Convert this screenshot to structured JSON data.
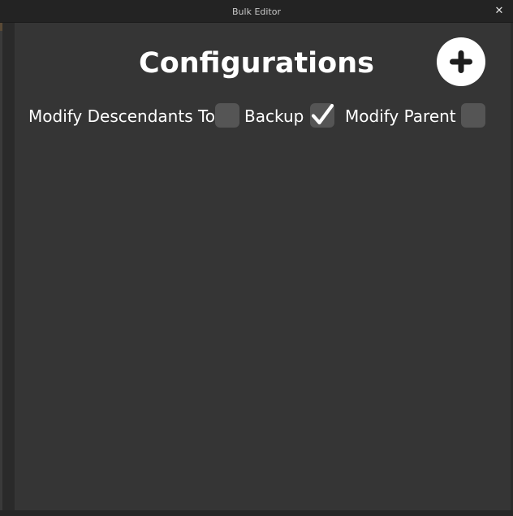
{
  "window": {
    "title": "Bulk Editor",
    "close_glyph": "✕"
  },
  "main": {
    "heading": "Configurations",
    "add_icon": "plus-icon"
  },
  "options": [
    {
      "label": "Modify Descendants Too",
      "checked": false
    },
    {
      "label": "Backup",
      "checked": true
    },
    {
      "label": "Modify Parent",
      "checked": false
    }
  ],
  "colors": {
    "background": "#353535",
    "titlebar": "#232323",
    "checkbox": "#555555",
    "text": "#ffffff"
  }
}
